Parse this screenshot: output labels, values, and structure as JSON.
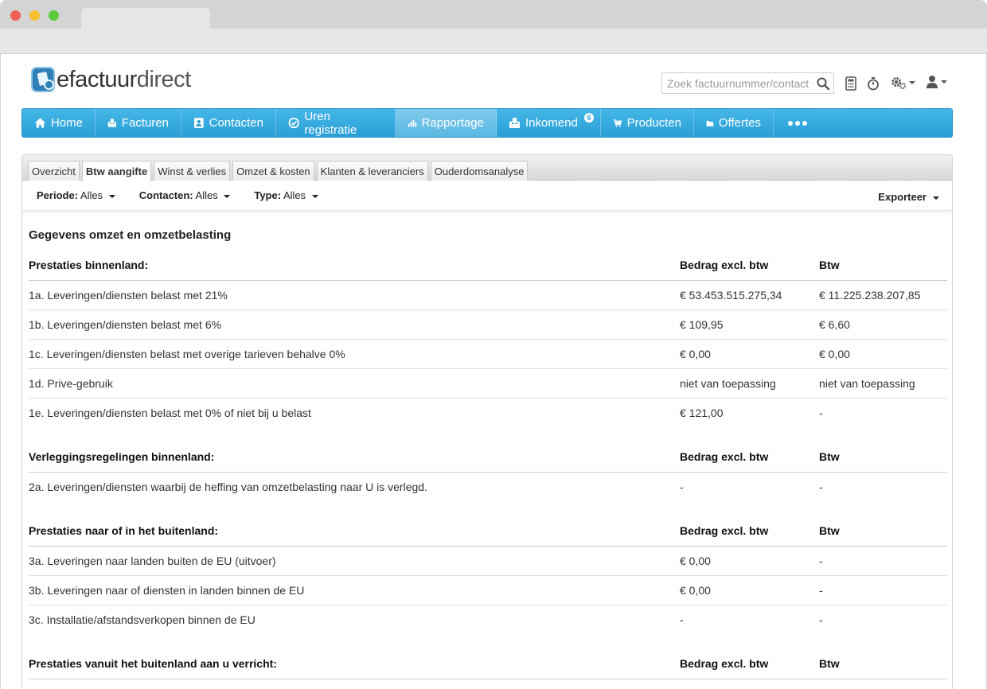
{
  "app": {
    "logo_part1": "efactuur",
    "logo_part2": "direct"
  },
  "search": {
    "placeholder": "Zoek factuurnummer/contact"
  },
  "nav": {
    "items": [
      {
        "label": "Home",
        "icon": "home-icon"
      },
      {
        "label": "Facturen",
        "icon": "invoice-icon"
      },
      {
        "label": "Contacten",
        "icon": "contacts-icon"
      },
      {
        "label": "Uren registratie",
        "icon": "clock-check-icon"
      },
      {
        "label": "Rapportage",
        "icon": "bar-chart-icon",
        "active": true
      },
      {
        "label": "Inkomend",
        "icon": "inbox-icon",
        "badge": "6"
      },
      {
        "label": "Producten",
        "icon": "cart-icon"
      },
      {
        "label": "Offertes",
        "icon": "folder-icon"
      }
    ]
  },
  "subtabs": [
    {
      "label": "Overzicht"
    },
    {
      "label": "Btw aangifte",
      "active": true
    },
    {
      "label": "Winst & verlies"
    },
    {
      "label": "Omzet & kosten"
    },
    {
      "label": "Klanten & leveranciers"
    },
    {
      "label": "Ouderdomsanalyse"
    }
  ],
  "filters": {
    "periode_label": "Periode:",
    "periode_value": "Alles",
    "contacten_label": "Contacten:",
    "contacten_value": "Alles",
    "type_label": "Type:",
    "type_value": "Alles",
    "export_label": "Exporteer"
  },
  "report": {
    "title": "Gegevens omzet en omzetbelasting",
    "groups": [
      {
        "heading": "Prestaties binnenland:",
        "col_amount": "Bedrag excl. btw",
        "col_vat": "Btw",
        "rows": [
          {
            "label": "1a. Leveringen/diensten belast met 21%",
            "amount": "€ 53.453.515.275,34",
            "vat": "€ 11.225.238.207,85"
          },
          {
            "label": "1b. Leveringen/diensten belast met 6%",
            "amount": "€ 109,95",
            "vat": "€ 6,60"
          },
          {
            "label": "1c. Leveringen/diensten belast met overige tarieven behalve 0%",
            "amount": "€ 0,00",
            "vat": "€ 0,00"
          },
          {
            "label": "1d. Prive-gebruik",
            "amount": "niet van toepassing",
            "vat": "niet van toepassing"
          },
          {
            "label": "1e. Leveringen/diensten belast met 0% of niet bij u belast",
            "amount": "€ 121,00",
            "vat": "-"
          }
        ]
      },
      {
        "heading": "Verleggingsregelingen binnenland:",
        "col_amount": "Bedrag excl. btw",
        "col_vat": "Btw",
        "rows": [
          {
            "label": "2a. Leveringen/diensten waarbij de heffing van omzetbelasting naar U is verlegd.",
            "amount": "-",
            "vat": "-"
          }
        ]
      },
      {
        "heading": "Prestaties naar of in het buitenland:",
        "col_amount": "Bedrag excl. btw",
        "col_vat": "Btw",
        "rows": [
          {
            "label": "3a. Leveringen naar landen buiten de EU (uitvoer)",
            "amount": "€ 0,00",
            "vat": "-"
          },
          {
            "label": "3b. Leveringen naar of diensten in landen binnen de EU",
            "amount": "€ 0,00",
            "vat": "-"
          },
          {
            "label": "3c. Installatie/afstandsverkopen binnen de EU",
            "amount": "-",
            "vat": "-"
          }
        ]
      },
      {
        "heading": "Prestaties vanuit het buitenland aan u verricht:",
        "col_amount": "Bedrag excl. btw",
        "col_vat": "Btw",
        "rows": []
      }
    ]
  }
}
